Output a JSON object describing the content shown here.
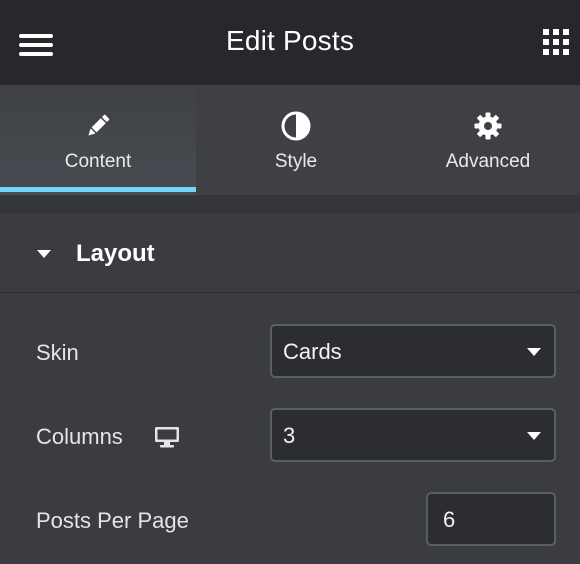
{
  "header": {
    "title": "Edit Posts",
    "menu_icon": "hamburger-menu-icon",
    "apps_icon": "grid-apps-icon"
  },
  "tabs": [
    {
      "label": "Content",
      "icon": "pencil-icon",
      "active": true
    },
    {
      "label": "Style",
      "icon": "half-circle-contrast-icon",
      "active": false
    },
    {
      "label": "Advanced",
      "icon": "gear-icon",
      "active": false
    }
  ],
  "section": {
    "title": "Layout",
    "expanded": true
  },
  "controls": {
    "skin": {
      "label": "Skin",
      "value": "Cards"
    },
    "columns": {
      "label": "Columns",
      "value": "3",
      "device_icon": "desktop-monitor-icon"
    },
    "posts_per_page": {
      "label": "Posts Per Page",
      "value": "6"
    }
  },
  "colors": {
    "accent": "#71d7f7",
    "header_bg": "#26282c",
    "panel_bg": "#3a3c41",
    "input_bg": "#2b2d31"
  }
}
